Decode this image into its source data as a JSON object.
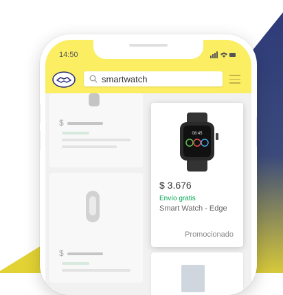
{
  "status_bar": {
    "time": "14:50"
  },
  "search": {
    "query": "smartwatch"
  },
  "featured_product": {
    "price": "$ 3.676",
    "shipping": "Envío gratis",
    "name": "Smart Watch - Edge",
    "badge": "Promocionado"
  },
  "placeholder_cards": [
    {
      "price_sign": "$"
    },
    {
      "price_sign": "$"
    }
  ],
  "colors": {
    "header_yellow": "#fbee63",
    "shipping_green": "#00a650",
    "navy": "#2d3f77",
    "gold": "#d9cc3d"
  }
}
